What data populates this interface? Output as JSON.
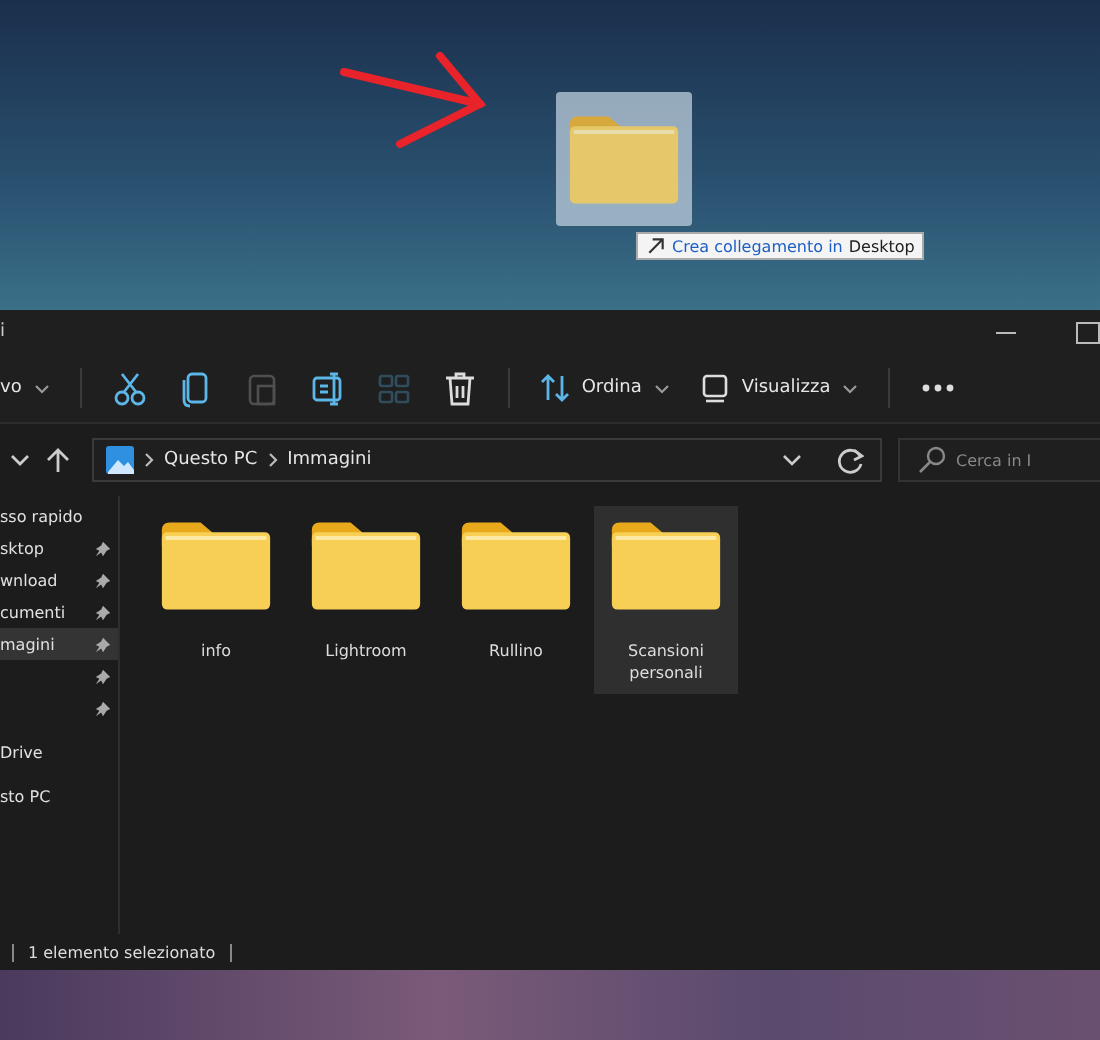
{
  "desktop": {
    "dragged_item": {
      "selected": true
    },
    "drag_tooltip": {
      "action": "Crea collegamento in",
      "target": "Desktop"
    }
  },
  "window": {
    "title": "i"
  },
  "toolbar": [
    {
      "kind": "dropdown",
      "label": "vo",
      "disabled": false
    },
    {
      "kind": "separator"
    },
    {
      "kind": "cut",
      "disabled": false
    },
    {
      "kind": "copy",
      "disabled": false
    },
    {
      "kind": "paste",
      "disabled": true
    },
    {
      "kind": "rename",
      "disabled": false
    },
    {
      "kind": "share",
      "disabled": true
    },
    {
      "kind": "delete",
      "disabled": false
    },
    {
      "kind": "separator"
    },
    {
      "kind": "sort",
      "label": "Ordina",
      "disabled": false
    },
    {
      "kind": "view",
      "label": "Visualizza",
      "disabled": false
    },
    {
      "kind": "separator"
    },
    {
      "kind": "more",
      "disabled": false
    }
  ],
  "address": {
    "path": [
      "Questo PC",
      "Immagini"
    ]
  },
  "search": {
    "placeholder": "Cerca in I"
  },
  "sidebar": {
    "items": [
      {
        "label": "sso rapido",
        "pinned": false,
        "selected": false
      },
      {
        "label": "sktop",
        "pinned": true,
        "selected": false
      },
      {
        "label": "wnload",
        "pinned": true,
        "selected": false
      },
      {
        "label": "cumenti",
        "pinned": true,
        "selected": false
      },
      {
        "label": "magini",
        "pinned": true,
        "selected": true
      },
      {
        "pinned": true,
        "selected": false
      },
      {
        "pinned": true,
        "selected": false
      },
      {
        "label": "Drive",
        "pinned": false,
        "selected": false
      },
      {
        "label": "sto PC",
        "pinned": false,
        "selected": false
      }
    ]
  },
  "folders": [
    {
      "name": "info",
      "selected": false
    },
    {
      "name": "Lightroom",
      "selected": false
    },
    {
      "name": "Rullino",
      "selected": false
    },
    {
      "name": "Scansioni personali",
      "selected": true
    }
  ],
  "status_bar": {
    "selection": "1 elemento selezionato"
  }
}
